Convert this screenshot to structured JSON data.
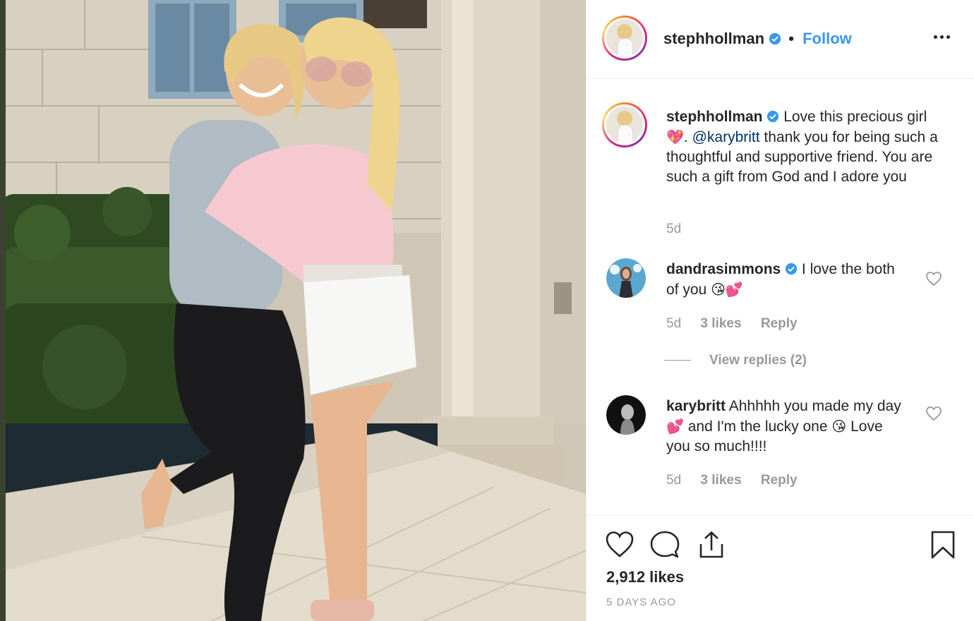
{
  "post": {
    "photo_alt": "",
    "likes": "2,912 likes",
    "age": "5 DAYS AGO"
  },
  "header": {
    "username": "stephhollman",
    "separator": "•",
    "follow_label": "Follow",
    "more_icon": "more-horizontal-icon"
  },
  "caption": {
    "username": "stephhollman",
    "text_before_emoji": "Love this precious girl",
    "emoji": "💖",
    "text_before_mention": ". ",
    "mention": "@karybritt",
    "text_after_mention": " thank you for being such a thoughtful and supportive friend. You are such a gift from God and I adore you",
    "time": "5d"
  },
  "comments": [
    {
      "username": "dandrasimmons",
      "text": "I love the both of you",
      "emoji": "😘💕",
      "time": "5d",
      "likes": "3 likes",
      "reply_label": "Reply"
    },
    {
      "username": "karybritt",
      "text_a": "Ahhhhh you made my day",
      "emoji_a": "💕",
      "text_b": "and I'm the lucky one",
      "emoji_b": "😘",
      "text_c": "Love you so much!!!!",
      "time": "5d",
      "likes": "3 likes",
      "reply_label": "Reply"
    }
  ],
  "view_replies": "View replies (2)",
  "colors": {
    "accent": "#3897f0",
    "verified": "#3897f0",
    "muted": "#999999",
    "text": "#262626",
    "mention": "#003569"
  },
  "icons": [
    "heart-icon",
    "comment-icon",
    "share-icon",
    "bookmark-icon",
    "verified-badge-icon"
  ]
}
